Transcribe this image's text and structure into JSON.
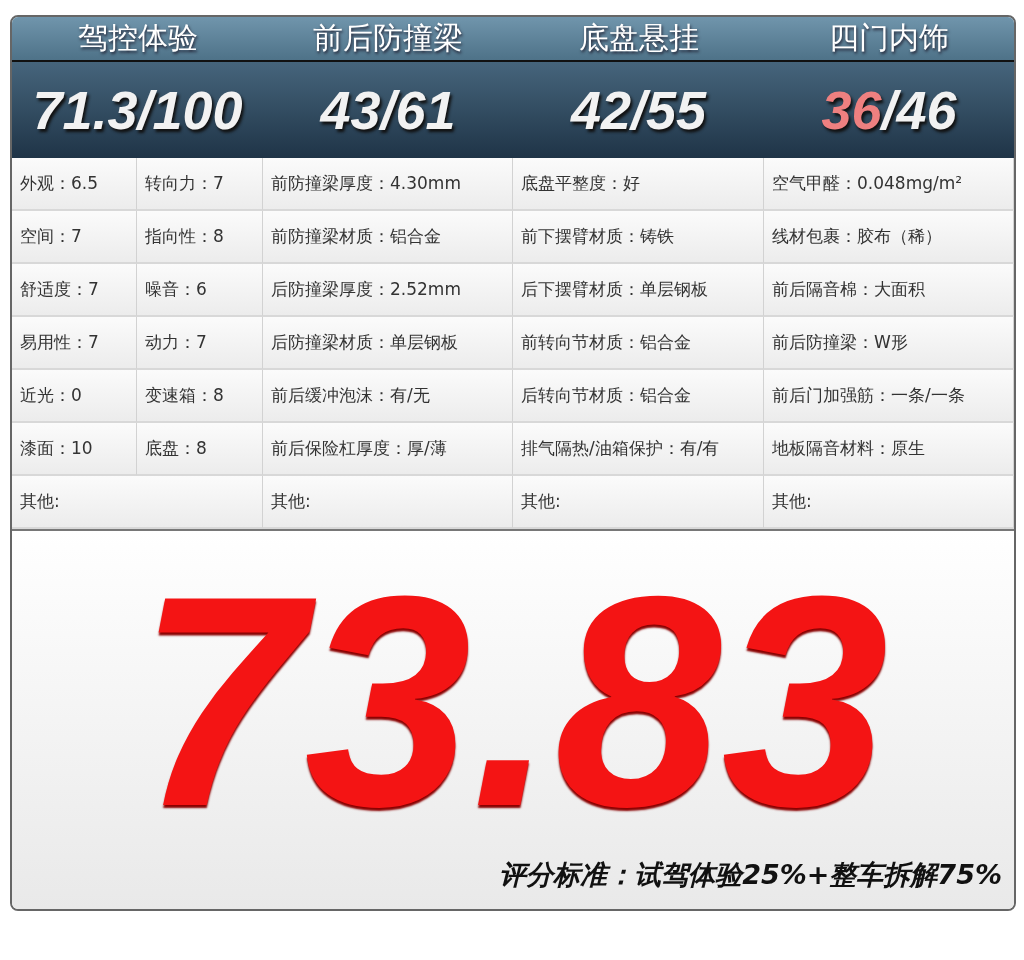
{
  "sections": [
    {
      "title": "驾控体验",
      "earned": "71.3",
      "total": "/100",
      "low": false
    },
    {
      "title": "前后防撞梁",
      "earned": "43",
      "total": "/61",
      "low": false
    },
    {
      "title": "底盘悬挂",
      "earned": "42",
      "total": "/55",
      "low": false
    },
    {
      "title": "四门内饰",
      "earned": "36",
      "total": "/46",
      "low": true
    }
  ],
  "rows": [
    [
      "外观：6.5",
      "转向力：7",
      "前防撞梁厚度：4.30mm",
      "底盘平整度：好",
      "空气甲醛：0.048mg/m²"
    ],
    [
      "空间：7",
      "指向性：8",
      "前防撞梁材质：铝合金",
      "前下摆臂材质：铸铁",
      "线材包裹：胶布（稀）"
    ],
    [
      "舒适度：7",
      "噪音：6",
      "后防撞梁厚度：2.52mm",
      "后下摆臂材质：单层钢板",
      "前后隔音棉：大面积"
    ],
    [
      "易用性：7",
      "动力：7",
      "后防撞梁材质：单层钢板",
      "前转向节材质：铝合金",
      "前后防撞梁：W形"
    ],
    [
      "近光：0",
      "变速箱：8",
      "前后缓冲泡沫：有/无",
      "后转向节材质：铝合金",
      "前后门加强筋：一条/一条"
    ],
    [
      "漆面：10",
      "底盘：8",
      "前后保险杠厚度：厚/薄",
      "排气隔热/油箱保护：有/有",
      "地板隔音材料：原生"
    ]
  ],
  "other_row": [
    "其他:",
    "其他:",
    "其他:",
    "其他:"
  ],
  "total_score": "73.83",
  "footnote": "评分标准：试驾体验25%+整车拆解75%"
}
